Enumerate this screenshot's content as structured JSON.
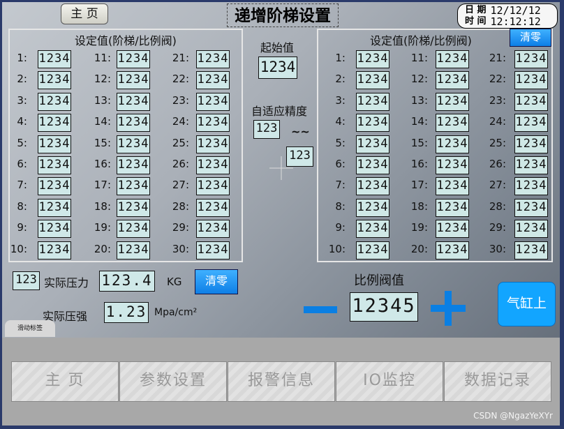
{
  "header": {
    "home_label": "主 页",
    "title": "递增阶梯设置",
    "date_label": "日 期",
    "date_value": "12/12/12",
    "time_label": "时 间",
    "time_value": "12:12:12"
  },
  "left_panel": {
    "title": "设定值(阶梯/比例阀)",
    "items": [
      {
        "n": "1:",
        "v": "1234"
      },
      {
        "n": "2:",
        "v": "1234"
      },
      {
        "n": "3:",
        "v": "1234"
      },
      {
        "n": "4:",
        "v": "1234"
      },
      {
        "n": "5:",
        "v": "1234"
      },
      {
        "n": "6:",
        "v": "1234"
      },
      {
        "n": "7:",
        "v": "1234"
      },
      {
        "n": "8:",
        "v": "1234"
      },
      {
        "n": "9:",
        "v": "1234"
      },
      {
        "n": "10:",
        "v": "1234"
      },
      {
        "n": "11:",
        "v": "1234"
      },
      {
        "n": "12:",
        "v": "1234"
      },
      {
        "n": "13:",
        "v": "1234"
      },
      {
        "n": "14:",
        "v": "1234"
      },
      {
        "n": "15:",
        "v": "1234"
      },
      {
        "n": "16:",
        "v": "1234"
      },
      {
        "n": "17:",
        "v": "1234"
      },
      {
        "n": "18:",
        "v": "1234"
      },
      {
        "n": "19:",
        "v": "1234"
      },
      {
        "n": "20:",
        "v": "1234"
      },
      {
        "n": "21:",
        "v": "1234"
      },
      {
        "n": "22:",
        "v": "1234"
      },
      {
        "n": "23:",
        "v": "1234"
      },
      {
        "n": "24:",
        "v": "1234"
      },
      {
        "n": "25:",
        "v": "1234"
      },
      {
        "n": "26:",
        "v": "1234"
      },
      {
        "n": "27:",
        "v": "1234"
      },
      {
        "n": "28:",
        "v": "1234"
      },
      {
        "n": "29:",
        "v": "1234"
      },
      {
        "n": "30:",
        "v": "1234"
      }
    ]
  },
  "right_panel": {
    "title": "设定值(阶梯/比例阀)",
    "clear_label": "清零",
    "items": [
      {
        "n": "1:",
        "v": "1234"
      },
      {
        "n": "2:",
        "v": "1234"
      },
      {
        "n": "3:",
        "v": "1234"
      },
      {
        "n": "4:",
        "v": "1234"
      },
      {
        "n": "5:",
        "v": "1234"
      },
      {
        "n": "6:",
        "v": "1234"
      },
      {
        "n": "7:",
        "v": "1234"
      },
      {
        "n": "8:",
        "v": "1234"
      },
      {
        "n": "9:",
        "v": "1234"
      },
      {
        "n": "10:",
        "v": "1234"
      },
      {
        "n": "11:",
        "v": "1234"
      },
      {
        "n": "12:",
        "v": "1234"
      },
      {
        "n": "13:",
        "v": "1234"
      },
      {
        "n": "14:",
        "v": "1234"
      },
      {
        "n": "15:",
        "v": "1234"
      },
      {
        "n": "16:",
        "v": "1234"
      },
      {
        "n": "17:",
        "v": "1234"
      },
      {
        "n": "18:",
        "v": "1234"
      },
      {
        "n": "19:",
        "v": "1234"
      },
      {
        "n": "20:",
        "v": "1234"
      },
      {
        "n": "21:",
        "v": "1234"
      },
      {
        "n": "22:",
        "v": "1234"
      },
      {
        "n": "23:",
        "v": "1234"
      },
      {
        "n": "24:",
        "v": "1234"
      },
      {
        "n": "25:",
        "v": "1234"
      },
      {
        "n": "26:",
        "v": "1234"
      },
      {
        "n": "27:",
        "v": "1234"
      },
      {
        "n": "28:",
        "v": "1234"
      },
      {
        "n": "29:",
        "v": "1234"
      },
      {
        "n": "30:",
        "v": "1234"
      }
    ]
  },
  "middle": {
    "start_label": "起始值",
    "start_value": "1234",
    "precision_label": "自适应精度",
    "precision_value": "123",
    "tilde": "~~",
    "precision_value2": "123"
  },
  "pressure": {
    "small_value": "123",
    "force_label": "实际压力",
    "force_value": "123.4",
    "force_unit": "KG",
    "clear_label": "清零",
    "stress_label": "实际压强",
    "stress_value": "1.23",
    "stress_unit": "Mpa/cm²"
  },
  "valve": {
    "label": "比例阀值",
    "value": "12345",
    "minus": "minus-icon",
    "plus": "plus-icon"
  },
  "cylinder_button": "气缸上",
  "slide_tab": "滑动标签",
  "nav": [
    {
      "label": "主 页"
    },
    {
      "label": "参数设置"
    },
    {
      "label": "报警信息"
    },
    {
      "label": "IO监控"
    },
    {
      "label": "数据记录"
    }
  ],
  "watermark": "CSDN @NgazYeXYr",
  "colors": {
    "accent_blue": "#0a7fe3",
    "value_box": "#cfe8e8"
  }
}
